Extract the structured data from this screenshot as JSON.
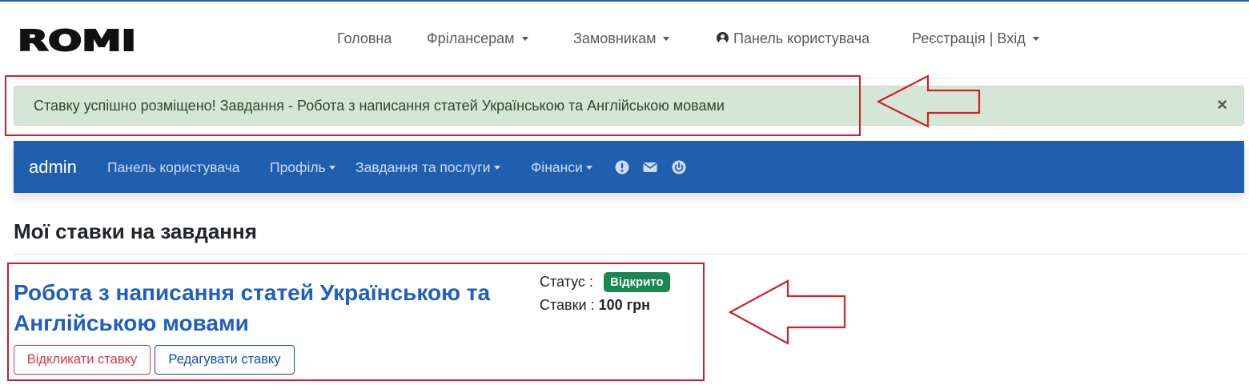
{
  "logo": {
    "text": "ROMI"
  },
  "top_nav": {
    "items": [
      {
        "label": "Головна",
        "dropdown": false
      },
      {
        "label": "Фрілансерам",
        "dropdown": true
      },
      {
        "label": "Замовникам",
        "dropdown": true
      },
      {
        "label": "Панель користувача",
        "icon": "user-circle-icon",
        "dropdown": false
      },
      {
        "label": "Реєстрація | Вхід",
        "dropdown": true
      }
    ]
  },
  "alert": {
    "text": "Ставку успішно розміщено! Завдання - Робота з написання статей Українською та Англійською мовами",
    "close": "×",
    "color": "#d6e6d6"
  },
  "user_nav": {
    "brand": "admin",
    "items": [
      {
        "label": "Панель користувача",
        "dropdown": false
      },
      {
        "label": "Профіль",
        "dropdown": true
      },
      {
        "label": "Завдання та послуги",
        "dropdown": true
      },
      {
        "label": "Фінанси",
        "dropdown": true
      }
    ],
    "icons": [
      "alert-icon",
      "envelope-icon",
      "power-icon"
    ],
    "color": "#1f5fae"
  },
  "section": {
    "title": "Мої ставки на завдання"
  },
  "bid": {
    "title": "Робота з написання статей Українською та Англійською мовами",
    "status_label": "Статус :",
    "status_value": "Відкрито",
    "status_color": "#198754",
    "bids_label": "Ставки :",
    "bids_value": "100 грн",
    "revoke_button": "Відкликати ставку",
    "edit_button": "Редагувати ставку"
  }
}
